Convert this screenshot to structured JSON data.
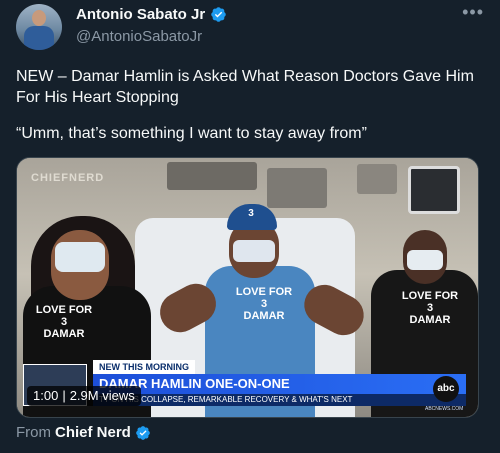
{
  "author": {
    "display_name": "Antonio Sabato Jr",
    "handle": "@AntonioSabatoJr",
    "verified": true
  },
  "tweet": {
    "line1": "NEW – Damar Hamlin is Asked What Reason Doctors Gave Him For His Heart Stopping",
    "line2": "“Umm, that’s something I want to stay away from”"
  },
  "more_icon": "more-horizontal-icon",
  "video": {
    "watermark": "CHIEFNERD",
    "shirt_left": "LOVE FOR\n3\nDAMAR",
    "shirt_mid": "LOVE FOR\n3\nDAMAR",
    "shirt_right": "LOVE FOR\n3\nDAMAR",
    "cap_number": "3",
    "lower_third": {
      "kicker": "NEW THIS MORNING",
      "headline": "DAMAR HAMLIN ONE-ON-ONE",
      "subline": "TY ON HIS COLLAPSE, REMARKABLE RECOVERY & WHAT'S NEXT"
    },
    "network_logo": "abc",
    "network_url": "ABCNEWS.COM",
    "duration": "1:00",
    "views": "2.9M views"
  },
  "source": {
    "prefix": "From",
    "name": "Chief Nerd",
    "verified": true
  },
  "colors": {
    "background": "#15202b",
    "verified_blue": "#1d9bf0",
    "secondary_text": "#8b98a5"
  }
}
